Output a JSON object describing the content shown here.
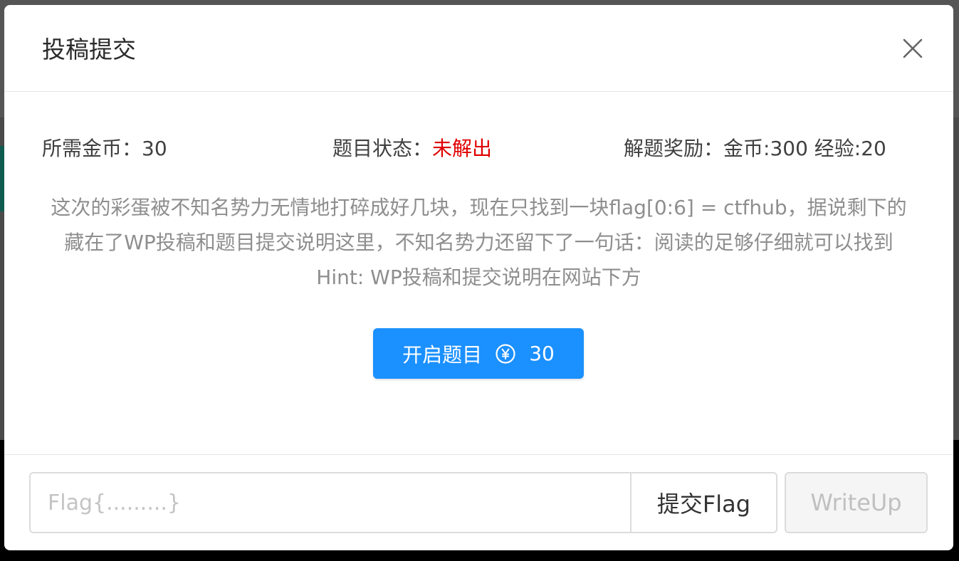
{
  "modal": {
    "title": "投稿提交",
    "close_icon": "close-icon"
  },
  "info": {
    "cost_label": "所需金币：",
    "cost_value": "30",
    "status_label": "题目状态：",
    "status_value": "未解出",
    "status_color": "#e00000",
    "reward_label": "解题奖励：",
    "reward_value": "金币:300 经验:20"
  },
  "description": {
    "text": "这次的彩蛋被不知名势力无情地打碎成好几块，现在只找到一块flag[0:6] = ctfhub，据说剩下的藏在了WP投稿和题目提交说明这里，不知名势力还留下了一句话：阅读的足够仔细就可以找到 Hint: WP投稿和提交说明在网站下方"
  },
  "start_button": {
    "label": "开启题目",
    "icon": "yen-coin-icon",
    "cost": "30",
    "color": "#1b90ff"
  },
  "footer": {
    "flag_placeholder": "Flag{.........}",
    "flag_value": "",
    "submit_label": "提交Flag",
    "writeup_label": "WriteUp"
  }
}
